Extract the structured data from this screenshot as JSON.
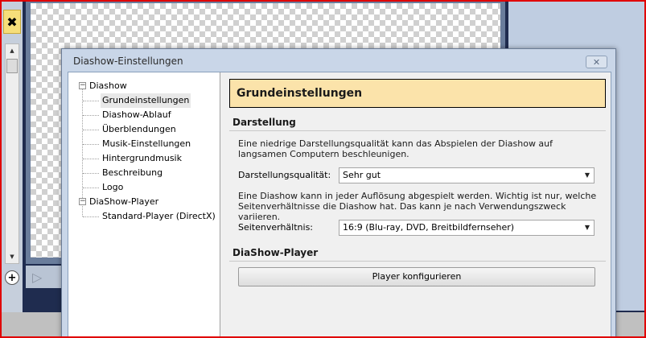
{
  "background": {
    "delete_glyph": "✖",
    "add_glyph": "+",
    "play_glyph": "▷"
  },
  "dialog": {
    "title": "Diashow-Einstellungen",
    "close_glyph": "✕"
  },
  "tree": {
    "root1": {
      "toggle": "−",
      "label": "Diashow",
      "children": [
        "Grundeinstellungen",
        "Diashow-Ablauf",
        "Überblendungen",
        "Musik-Einstellungen",
        "Hintergrundmusik",
        "Beschreibung",
        "Logo"
      ]
    },
    "root2": {
      "toggle": "−",
      "label": "DiaShow-Player",
      "children": [
        "Standard-Player (DirectX)"
      ]
    },
    "selected": "Grundeinstellungen"
  },
  "content": {
    "header": "Grundeinstellungen",
    "darstellung": {
      "title": "Darstellung",
      "para1": "Eine niedrige Darstellungsqualität kann das Abspielen der Diashow auf langsamen Computern beschleunigen.",
      "quality_label": "Darstellungsqualität:",
      "quality_value": "Sehr gut",
      "para2": "Eine Diashow kann in jeder Auflösung abgespielt werden. Wichtig ist nur, welche Seitenverhältnisse die Diashow hat. Das kann je nach Verwendungszweck variieren.",
      "ratio_label": "Seitenverhältnis:",
      "ratio_value": "16:9 (Blu-ray, DVD, Breitbildfernseher)"
    },
    "player": {
      "title": "DiaShow-Player",
      "button_label": "Player konfigurieren"
    }
  }
}
